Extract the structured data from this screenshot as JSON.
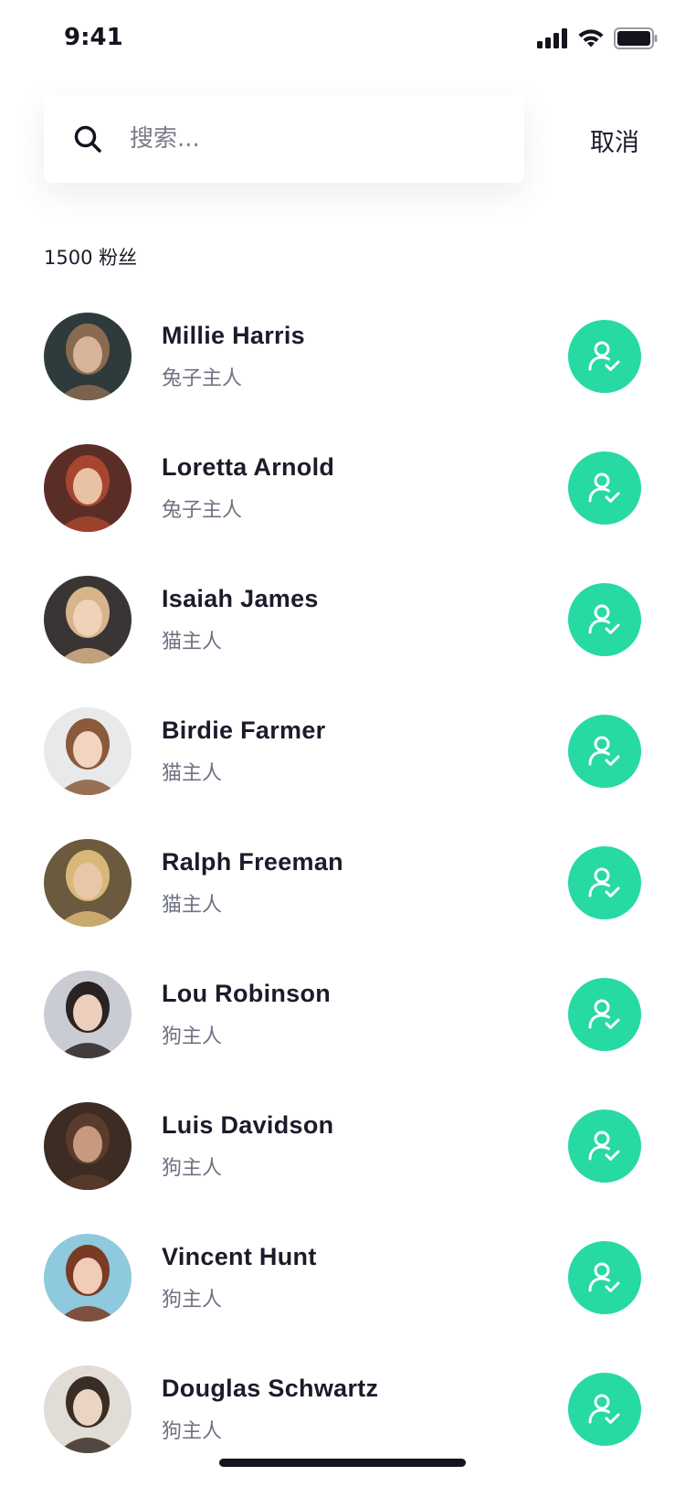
{
  "status_bar": {
    "time": "9:41",
    "icons": [
      "signal-icon",
      "wifi-icon",
      "battery-icon"
    ]
  },
  "search": {
    "placeholder": "搜索...",
    "value": "",
    "icon": "search-icon",
    "cancel_label": "取消"
  },
  "followers": {
    "count_label": "1500 粉丝"
  },
  "colors": {
    "accent": "#27d9a3",
    "text_primary": "#1c1b2b",
    "text_secondary": "#6f7282"
  },
  "users": [
    {
      "name": "Millie Harris",
      "subtitle": "兔子主人",
      "avatar": "avatar-photo",
      "action_icon": "user-check-icon"
    },
    {
      "name": "Loretta Arnold",
      "subtitle": "兔子主人",
      "avatar": "avatar-photo",
      "action_icon": "user-check-icon"
    },
    {
      "name": "Isaiah James",
      "subtitle": "猫主人",
      "avatar": "avatar-photo",
      "action_icon": "user-check-icon"
    },
    {
      "name": "Birdie Farmer",
      "subtitle": "猫主人",
      "avatar": "avatar-photo",
      "action_icon": "user-check-icon"
    },
    {
      "name": "Ralph Freeman",
      "subtitle": "猫主人",
      "avatar": "avatar-photo",
      "action_icon": "user-check-icon"
    },
    {
      "name": "Lou Robinson",
      "subtitle": "狗主人",
      "avatar": "avatar-photo",
      "action_icon": "user-check-icon"
    },
    {
      "name": "Luis Davidson",
      "subtitle": "狗主人",
      "avatar": "avatar-photo",
      "action_icon": "user-check-icon"
    },
    {
      "name": "Vincent Hunt",
      "subtitle": "狗主人",
      "avatar": "avatar-photo",
      "action_icon": "user-check-icon"
    },
    {
      "name": "Douglas Schwartz",
      "subtitle": "狗主人",
      "avatar": "avatar-photo",
      "action_icon": "user-check-icon"
    }
  ]
}
